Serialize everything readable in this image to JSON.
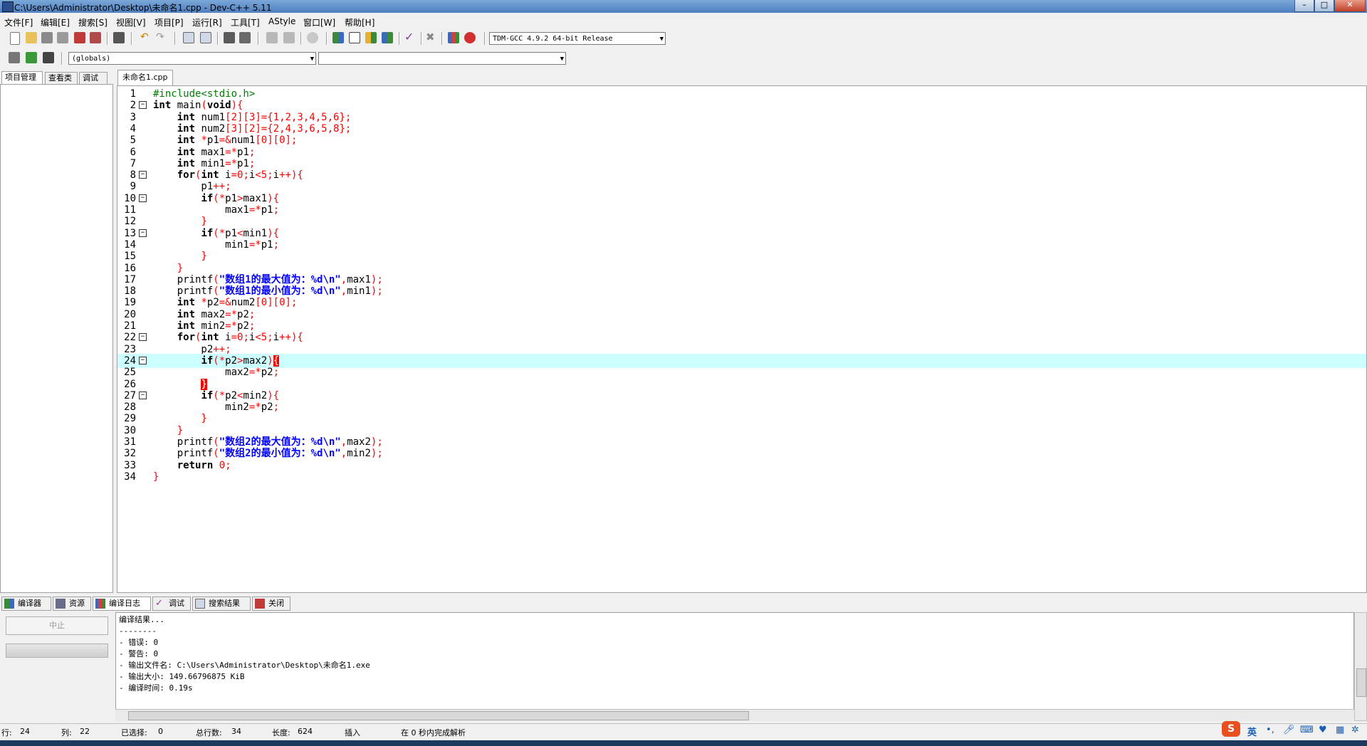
{
  "window": {
    "title": "C:\\Users\\Administrator\\Desktop\\未命名1.cpp - Dev-C++ 5.11",
    "controls": {
      "minimize": "–",
      "maximize": "□",
      "close": "✕"
    }
  },
  "menu": [
    "文件[F]",
    "编辑[E]",
    "搜索[S]",
    "视图[V]",
    "项目[P]",
    "运行[R]",
    "工具[T]",
    "AStyle",
    "窗口[W]",
    "帮助[H]"
  ],
  "toolbar": {
    "compiler_select": "TDM-GCC 4.9.2 64-bit Release",
    "scope_select": "(globals)",
    "symbol_select": ""
  },
  "left_tabs": [
    "项目管理",
    "查看类",
    "调试"
  ],
  "editor": {
    "tab_label": "未命名1.cpp",
    "highlighted_line": 24,
    "lines": [
      {
        "n": "1",
        "t": "#include<stdio.h>"
      },
      {
        "n": "2",
        "t": "int main(void){"
      },
      {
        "n": "3",
        "t": "    int num1[2][3]={1,2,3,4,5,6};"
      },
      {
        "n": "4",
        "t": "    int num2[3][2]={2,4,3,6,5,8};"
      },
      {
        "n": "5",
        "t": "    int *p1=&num1[0][0];"
      },
      {
        "n": "6",
        "t": "    int max1=*p1;"
      },
      {
        "n": "7",
        "t": "    int min1=*p1;"
      },
      {
        "n": "8",
        "t": "    for(int i=0;i<5;i++){"
      },
      {
        "n": "9",
        "t": "        p1++;"
      },
      {
        "n": "10",
        "t": "        if(*p1>max1){"
      },
      {
        "n": "11",
        "t": "            max1=*p1;"
      },
      {
        "n": "12",
        "t": "        }"
      },
      {
        "n": "13",
        "t": "        if(*p1<min1){"
      },
      {
        "n": "14",
        "t": "            min1=*p1;"
      },
      {
        "n": "15",
        "t": "        }"
      },
      {
        "n": "16",
        "t": "    }"
      },
      {
        "n": "17",
        "t": "    printf(\"数组1的最大值为：%d\\n\",max1);"
      },
      {
        "n": "18",
        "t": "    printf(\"数组1的最小值为：%d\\n\",min1);"
      },
      {
        "n": "19",
        "t": "    int *p2=&num2[0][0];"
      },
      {
        "n": "20",
        "t": "    int max2=*p2;"
      },
      {
        "n": "21",
        "t": "    int min2=*p2;"
      },
      {
        "n": "22",
        "t": "    for(int i=0;i<5;i++){"
      },
      {
        "n": "23",
        "t": "        p2++;"
      },
      {
        "n": "24",
        "t": "        if(*p2>max2){"
      },
      {
        "n": "25",
        "t": "            max2=*p2;"
      },
      {
        "n": "26",
        "t": "        }"
      },
      {
        "n": "27",
        "t": "        if(*p2<min2){"
      },
      {
        "n": "28",
        "t": "            min2=*p2;"
      },
      {
        "n": "29",
        "t": "        }"
      },
      {
        "n": "30",
        "t": "    }"
      },
      {
        "n": "31",
        "t": "    printf(\"数组2的最大值为：%d\\n\",max2);"
      },
      {
        "n": "32",
        "t": "    printf(\"数组2的最小值为：%d\\n\",min2);"
      },
      {
        "n": "33",
        "t": "    return 0;"
      },
      {
        "n": "34",
        "t": "}"
      }
    ]
  },
  "bottom_tabs": [
    "编译器",
    "资源",
    "编译日志",
    "调试",
    "搜索结果",
    "关闭"
  ],
  "active_bottom_tab": "编译日志",
  "abort_button": "中止",
  "log": [
    "编译结果...",
    "--------",
    "- 错误: 0",
    "- 警告: 0",
    "- 输出文件名: C:\\Users\\Administrator\\Desktop\\未命名1.exe",
    "- 输出大小: 149.66796875 KiB",
    "- 编译时间: 0.19s"
  ],
  "status": {
    "row_label": "行:",
    "row": "24",
    "col_label": "列:",
    "col": "22",
    "sel_label": "已选择:",
    "sel": "0",
    "total_label": "总行数:",
    "total": "34",
    "len_label": "长度:",
    "len": "624",
    "mode": "插入",
    "parse": "在 0 秒内完成解析"
  },
  "ime": {
    "lang": "英"
  }
}
